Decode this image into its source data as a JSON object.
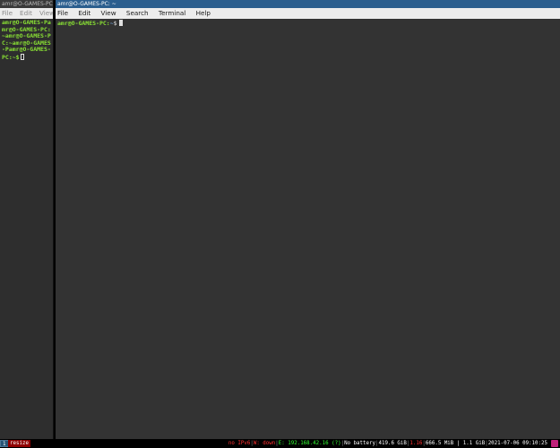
{
  "left_window": {
    "title": "amr@O-GAMES-PC: ~",
    "menu": [
      "File",
      "Edit",
      "View"
    ],
    "terminal_text": "amr@O-GAMES-Pamr@O-GAMES-PC:~amr@O-GAMES-PC:~amr@O-GAMES-Pamr@O-GAMES-PC:~$"
  },
  "right_window": {
    "title": "amr@O-GAMES-PC: ~",
    "menu": [
      "File",
      "Edit",
      "View",
      "Search",
      "Terminal",
      "Help"
    ],
    "prompt_user": "amr@O-GAMES-PC:",
    "prompt_path": "~",
    "prompt_symbol": "$"
  },
  "statusbar": {
    "workspace": "1",
    "mode": "resize",
    "ipv6": "no IPv6",
    "wifi": "W: down",
    "ethernet": "E: 192.168.42.16 (?)",
    "battery": "No battery",
    "disk": "419.6 GiB",
    "load": "1.16",
    "memory": "666.5 MiB | 1.1 GiB",
    "datetime": "2021-07-06 09:10:25"
  },
  "colors": {
    "prompt_green": "#8ae234",
    "active_title": "#2b5e8e",
    "terminal_bg": "#333333",
    "mode_bg": "#900000"
  }
}
